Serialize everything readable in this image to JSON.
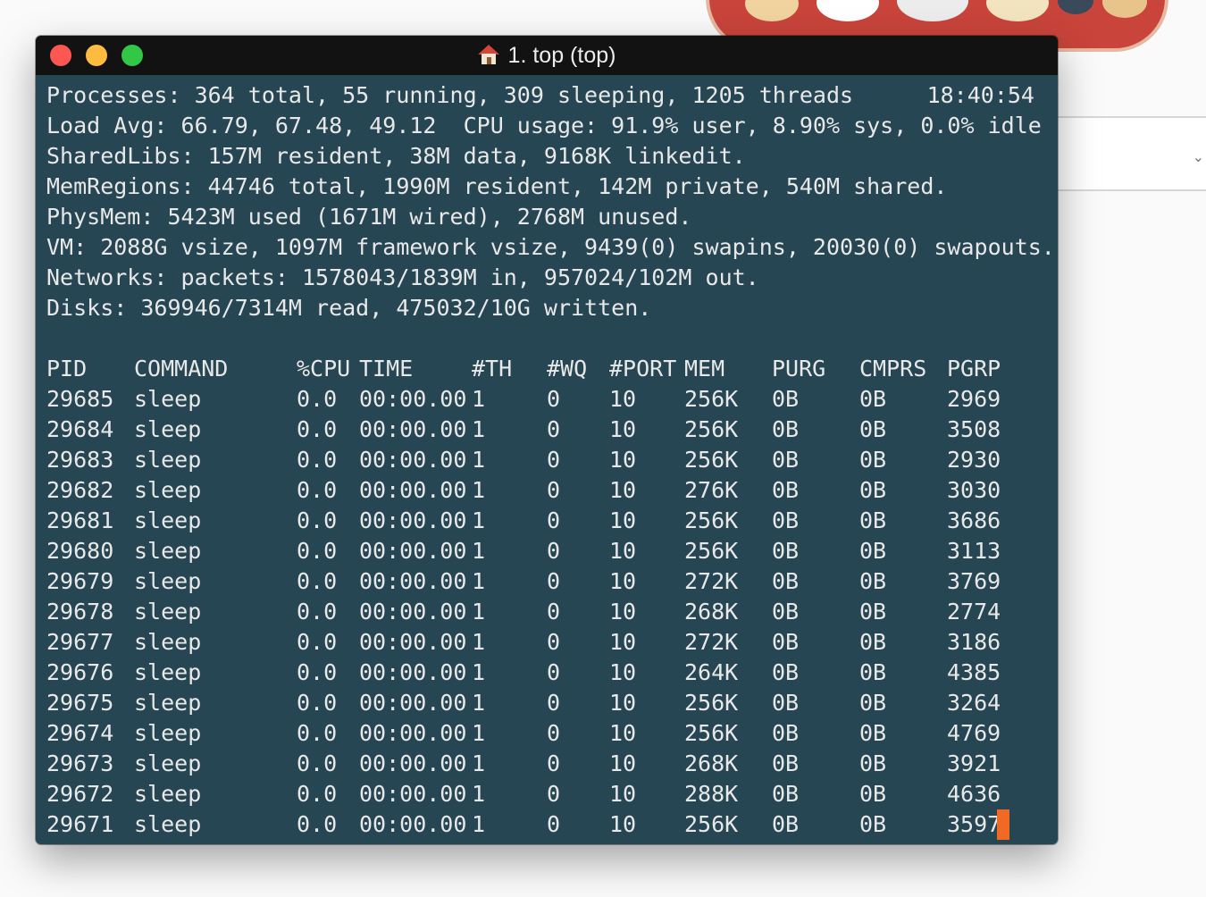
{
  "window": {
    "title": "1. top (top)"
  },
  "summary": {
    "clock": "18:40:54",
    "lines": [
      "Processes: 364 total, 55 running, 309 sleeping, 1205 threads",
      "Load Avg: 66.79, 67.48, 49.12  CPU usage: 91.9% user, 8.90% sys, 0.0% idle",
      "SharedLibs: 157M resident, 38M data, 9168K linkedit.",
      "MemRegions: 44746 total, 1990M resident, 142M private, 540M shared.",
      "PhysMem: 5423M used (1671M wired), 2768M unused.",
      "VM: 2088G vsize, 1097M framework vsize, 9439(0) swapins, 20030(0) swapouts.",
      "Networks: packets: 1578043/1839M in, 957024/102M out.",
      "Disks: 369946/7314M read, 475032/10G written."
    ]
  },
  "table": {
    "columns": [
      "PID",
      "COMMAND",
      "%CPU",
      "TIME",
      "#TH",
      "#WQ",
      "#PORT",
      "MEM",
      "PURG",
      "CMPRS",
      "PGRP"
    ],
    "rows": [
      [
        "29685",
        "sleep",
        "0.0",
        "00:00.00",
        "1",
        "0",
        "10",
        "256K",
        "0B",
        "0B",
        "2969"
      ],
      [
        "29684",
        "sleep",
        "0.0",
        "00:00.00",
        "1",
        "0",
        "10",
        "256K",
        "0B",
        "0B",
        "3508"
      ],
      [
        "29683",
        "sleep",
        "0.0",
        "00:00.00",
        "1",
        "0",
        "10",
        "256K",
        "0B",
        "0B",
        "2930"
      ],
      [
        "29682",
        "sleep",
        "0.0",
        "00:00.00",
        "1",
        "0",
        "10",
        "276K",
        "0B",
        "0B",
        "3030"
      ],
      [
        "29681",
        "sleep",
        "0.0",
        "00:00.00",
        "1",
        "0",
        "10",
        "256K",
        "0B",
        "0B",
        "3686"
      ],
      [
        "29680",
        "sleep",
        "0.0",
        "00:00.00",
        "1",
        "0",
        "10",
        "256K",
        "0B",
        "0B",
        "3113"
      ],
      [
        "29679",
        "sleep",
        "0.0",
        "00:00.00",
        "1",
        "0",
        "10",
        "272K",
        "0B",
        "0B",
        "3769"
      ],
      [
        "29678",
        "sleep",
        "0.0",
        "00:00.00",
        "1",
        "0",
        "10",
        "268K",
        "0B",
        "0B",
        "2774"
      ],
      [
        "29677",
        "sleep",
        "0.0",
        "00:00.00",
        "1",
        "0",
        "10",
        "272K",
        "0B",
        "0B",
        "3186"
      ],
      [
        "29676",
        "sleep",
        "0.0",
        "00:00.00",
        "1",
        "0",
        "10",
        "264K",
        "0B",
        "0B",
        "4385"
      ],
      [
        "29675",
        "sleep",
        "0.0",
        "00:00.00",
        "1",
        "0",
        "10",
        "256K",
        "0B",
        "0B",
        "3264"
      ],
      [
        "29674",
        "sleep",
        "0.0",
        "00:00.00",
        "1",
        "0",
        "10",
        "256K",
        "0B",
        "0B",
        "4769"
      ],
      [
        "29673",
        "sleep",
        "0.0",
        "00:00.00",
        "1",
        "0",
        "10",
        "268K",
        "0B",
        "0B",
        "3921"
      ],
      [
        "29672",
        "sleep",
        "0.0",
        "00:00.00",
        "1",
        "0",
        "10",
        "288K",
        "0B",
        "0B",
        "4636"
      ],
      [
        "29671",
        "sleep",
        "0.0",
        "00:00.00",
        "1",
        "0",
        "10",
        "256K",
        "0B",
        "0B",
        "3597"
      ]
    ]
  },
  "colors": {
    "terminal_bg": "#274653",
    "titlebar_bg": "#121212",
    "text": "#e8e8e8",
    "cursor": "#f06a24",
    "close": "#fc5753",
    "minimize": "#fdbc40",
    "zoom": "#33c748"
  },
  "icons": {
    "title": "home-icon",
    "background_window": "chevron-down-icon"
  }
}
